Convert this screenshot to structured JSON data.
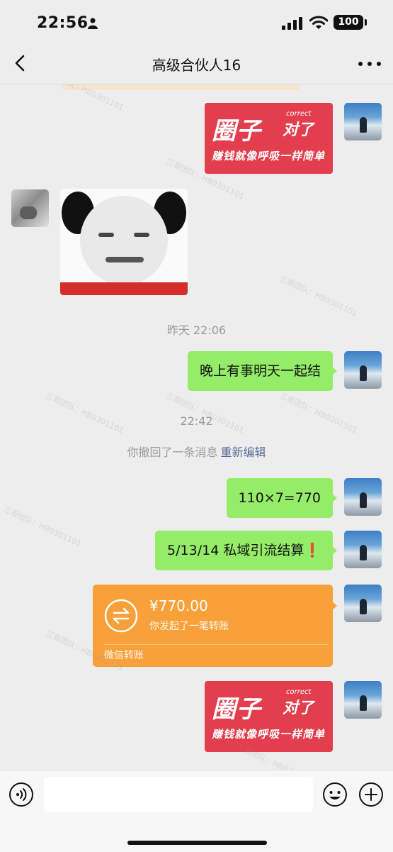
{
  "status_bar": {
    "time": "22:56",
    "battery": "100"
  },
  "nav": {
    "title": "高级合伙人16"
  },
  "stickers": {
    "big_text": "圈子",
    "correct": "correct",
    "right_text": "对了",
    "slogan": "赚钱就像呼吸一样简单"
  },
  "timestamps": [
    "昨天 22:06",
    "22:42"
  ],
  "messages": {
    "evening": "晚上有事明天一起结",
    "calc": "110×7=770",
    "settle": "5/13/14 私域引流结算❗"
  },
  "recall": {
    "text": "你撤回了一条消息",
    "link": "重新编辑"
  },
  "transfer": {
    "amount": "¥770.00",
    "desc": "你发起了一笔转账",
    "brand": "微信转账",
    "color": "#f8a13b"
  },
  "watermark": "三哥团队：HB0301101",
  "colors": {
    "my_bubble": "#95ec69",
    "background": "#ededed",
    "link": "#576b95"
  },
  "icons": [
    "person-icon",
    "signal-icon",
    "wifi-icon",
    "back-icon",
    "more-icon",
    "transfer-arrows-icon",
    "voice-icon",
    "emoji-icon",
    "plus-icon"
  ]
}
